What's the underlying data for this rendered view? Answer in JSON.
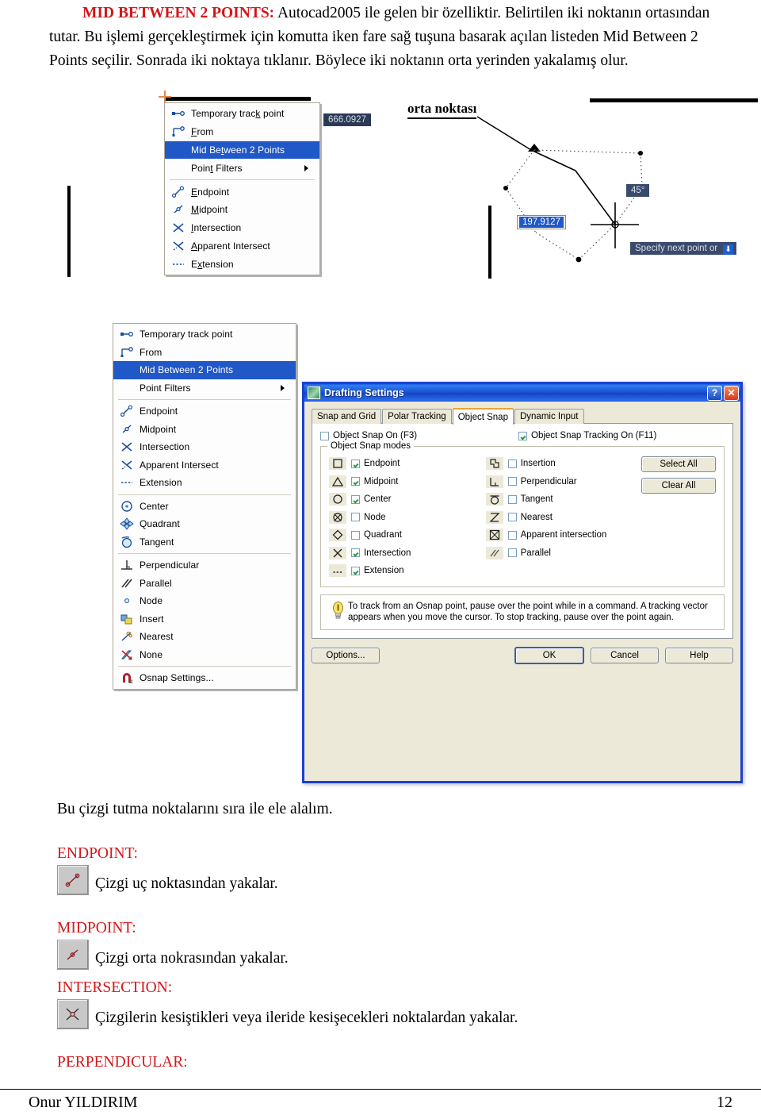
{
  "document": {
    "intro": {
      "heading": "MID BETWEEN 2 POINTS:",
      "line1_rest": " Autocad2005 ile gelen bir özelliktir. Belirtilen iki noktanın",
      "line2": "ortasından tutar. Bu işlemi gerçekleştirmek için komutta iken fare sağ tuşuna basarak açılan listeden",
      "line3": "Mid Between 2 Points seçilir. Sonrada iki noktaya tıklanır. Böylece iki noktanın orta yerinden",
      "line4": "yakalamış olur."
    },
    "drawing": {
      "midpoint_label": "orta noktası",
      "distance_chip": "666.0927",
      "length_value": "197.9127",
      "angle_chip": "45°",
      "prompt_chip": "Specify next point or"
    },
    "context_menu_small": {
      "items": [
        {
          "label": "Temporary track point",
          "underline": "k",
          "icon": "temporary-track-point-icon",
          "selected": false,
          "submenu": false
        },
        {
          "label": "From",
          "underline": "F",
          "icon": "from-icon",
          "selected": false,
          "submenu": false
        },
        {
          "label": "Mid Between 2 Points",
          "underline": "t",
          "icon": "none",
          "selected": true,
          "submenu": false
        },
        {
          "label": "Point Filters",
          "underline": "t",
          "icon": "none",
          "selected": false,
          "submenu": true
        },
        {
          "separator": true
        },
        {
          "label": "Endpoint",
          "underline": "E",
          "icon": "endpoint-icon",
          "selected": false,
          "submenu": false
        },
        {
          "label": "Midpoint",
          "underline": "M",
          "icon": "midpoint-icon",
          "selected": false,
          "submenu": false
        },
        {
          "label": "Intersection",
          "underline": "I",
          "icon": "intersection-icon",
          "selected": false,
          "submenu": false
        },
        {
          "label": "Apparent Intersect",
          "underline": "A",
          "icon": "apparent-intersect-icon",
          "selected": false,
          "submenu": false
        },
        {
          "label": "Extension",
          "underline": "x",
          "icon": "extension-icon",
          "selected": false,
          "submenu": false
        }
      ]
    },
    "context_menu_large": {
      "items": [
        {
          "label": "Temporary track point",
          "icon": "temporary-track-point-icon",
          "selected": false,
          "submenu": false
        },
        {
          "label": "From",
          "icon": "from-icon",
          "selected": false,
          "submenu": false
        },
        {
          "label": "Mid Between 2 Points",
          "icon": "none",
          "selected": true,
          "submenu": false
        },
        {
          "label": "Point Filters",
          "icon": "none",
          "selected": false,
          "submenu": true
        },
        {
          "separator": true
        },
        {
          "label": "Endpoint",
          "icon": "endpoint-icon",
          "selected": false,
          "submenu": false
        },
        {
          "label": "Midpoint",
          "icon": "midpoint-icon",
          "selected": false,
          "submenu": false
        },
        {
          "label": "Intersection",
          "icon": "intersection-icon",
          "selected": false,
          "submenu": false
        },
        {
          "label": "Apparent Intersect",
          "icon": "apparent-intersect-icon",
          "selected": false,
          "submenu": false
        },
        {
          "label": "Extension",
          "icon": "extension-icon",
          "selected": false,
          "submenu": false
        },
        {
          "separator": true
        },
        {
          "label": "Center",
          "icon": "center-icon",
          "selected": false,
          "submenu": false
        },
        {
          "label": "Quadrant",
          "icon": "quadrant-icon",
          "selected": false,
          "submenu": false
        },
        {
          "label": "Tangent",
          "icon": "tangent-icon",
          "selected": false,
          "submenu": false
        },
        {
          "separator": true
        },
        {
          "label": "Perpendicular",
          "icon": "perpendicular-icon",
          "selected": false,
          "submenu": false
        },
        {
          "label": "Parallel",
          "icon": "parallel-icon",
          "selected": false,
          "submenu": false
        },
        {
          "label": "Node",
          "icon": "node-icon",
          "selected": false,
          "submenu": false
        },
        {
          "label": "Insert",
          "icon": "insert-icon",
          "selected": false,
          "submenu": false
        },
        {
          "label": "Nearest",
          "icon": "nearest-icon",
          "selected": false,
          "submenu": false
        },
        {
          "label": "None",
          "icon": "none-icon",
          "selected": false,
          "submenu": false
        },
        {
          "separator": true
        },
        {
          "label": "Osnap Settings...",
          "icon": "osnap-settings-icon",
          "selected": false,
          "submenu": false
        }
      ]
    },
    "dialog": {
      "title": "Drafting Settings",
      "help_button": "?",
      "close_button": "✕",
      "tabs": [
        {
          "label": "Snap and Grid",
          "active": false
        },
        {
          "label": "Polar Tracking",
          "active": false
        },
        {
          "label": "Object Snap",
          "active": true
        },
        {
          "label": "Dynamic Input",
          "active": false
        }
      ],
      "object_snap_on": {
        "label": "Object Snap On (F3)",
        "checked": false
      },
      "object_snap_tracking_on": {
        "label": "Object Snap Tracking On (F11)",
        "checked": true
      },
      "group_title": "Object Snap modes",
      "modes_left": [
        {
          "label": "Endpoint",
          "checked": true,
          "glyph": "endpoint-square-icon"
        },
        {
          "label": "Midpoint",
          "checked": true,
          "glyph": "midpoint-triangle-icon"
        },
        {
          "label": "Center",
          "checked": true,
          "glyph": "center-circle-icon"
        },
        {
          "label": "Node",
          "checked": false,
          "glyph": "node-crossed-circle-icon"
        },
        {
          "label": "Quadrant",
          "checked": false,
          "glyph": "quadrant-diamond-icon"
        },
        {
          "label": "Intersection",
          "checked": true,
          "glyph": "intersection-x-icon"
        },
        {
          "label": "Extension",
          "checked": true,
          "glyph": "extension-dashes-icon"
        }
      ],
      "modes_right": [
        {
          "label": "Insertion",
          "checked": false,
          "glyph": "insertion-icon"
        },
        {
          "label": "Perpendicular",
          "checked": false,
          "glyph": "perpendicular-icon"
        },
        {
          "label": "Tangent",
          "checked": false,
          "glyph": "tangent-icon"
        },
        {
          "label": "Nearest",
          "checked": false,
          "glyph": "nearest-hourglass-icon"
        },
        {
          "label": "Apparent intersection",
          "checked": false,
          "glyph": "apparent-intersection-boxed-x-icon"
        },
        {
          "label": "Parallel",
          "checked": false,
          "glyph": "parallel-slashes-icon"
        }
      ],
      "select_all": "Select All",
      "clear_all": "Clear All",
      "tip": "To track from an Osnap point, pause over the point while in a command.  A tracking vector appears when you move the cursor. To stop tracking, pause over the point again.",
      "buttons": {
        "options": "Options...",
        "ok": "OK",
        "cancel": "Cancel",
        "help": "Help"
      }
    },
    "lower": {
      "intro": "Bu çizgi tutma noktalarını sıra ile ele alalım.",
      "entries": [
        {
          "heading": "ENDPOINT:",
          "icon": "endpoint-toolbar-icon",
          "text": "Çizgi uç noktasından yakalar."
        },
        {
          "heading": "MIDPOINT:",
          "icon": "midpoint-toolbar-icon",
          "text": "Çizgi orta nokrasından yakalar."
        },
        {
          "heading": "INTERSECTION:",
          "icon": "intersection-toolbar-icon",
          "text": "Çizgilerin kesiştikleri veya ileride kesişecekleri noktalardan yakalar."
        },
        {
          "heading": "PERPENDICULAR:",
          "icon": null,
          "text": ""
        }
      ]
    },
    "footer": {
      "author": "Onur YILDIRIM",
      "page": "12"
    },
    "colors": {
      "heading_red": "#d4171a",
      "menu_highlight": "#2158c8",
      "dialog_face": "#ece9d8",
      "titlebar_blue": "#1a4fd0",
      "check_green": "#1f9a3d"
    }
  }
}
